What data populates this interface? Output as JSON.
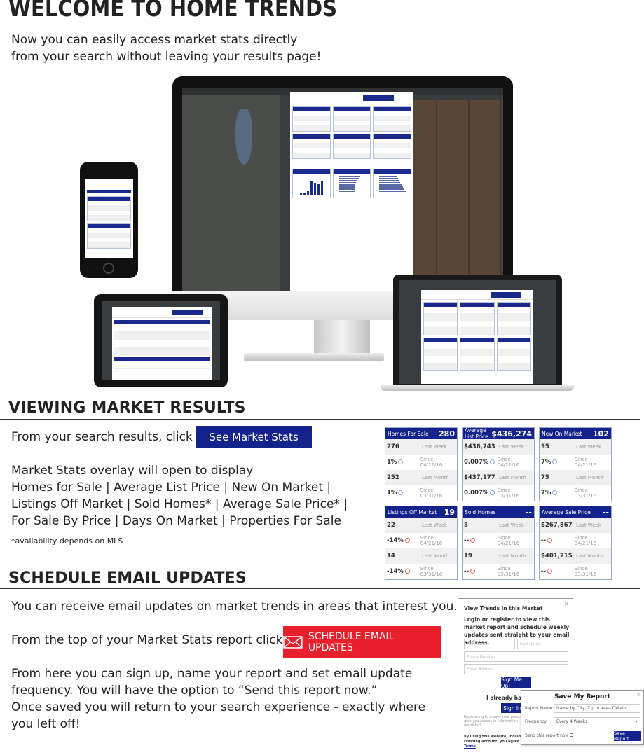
{
  "welcome": {
    "title": "WELCOME TO HOME TRENDS",
    "intro_line1": "Now you can easily access market stats directly",
    "intro_line2": "from your search without leaving your results page!"
  },
  "viewing": {
    "title": "VIEWING MARKET RESULTS",
    "click_text": "From your search results, click",
    "button_label": "See Market Stats",
    "overlay_line1": "Market Stats overlay will open to display",
    "overlay_line2": "Homes for Sale | Average List Price | New On Market |",
    "overlay_line3": "Listings Off Market | Sold Homes* | Average Sale Price* |",
    "overlay_line4": "For Sale By Price | Days On Market | Properties For Sale",
    "footnote": "*availability depends on MLS"
  },
  "stat_cards": [
    {
      "title": "Homes For Sale",
      "value": "280",
      "rows": [
        {
          "val": "276",
          "lbl": "Last Week",
          "icon": ""
        },
        {
          "val": "1%",
          "lbl": "Since 04/21/16",
          "icon": "question-icon"
        },
        {
          "val": "252",
          "lbl": "Last Month",
          "icon": ""
        },
        {
          "val": "1%",
          "lbl": "Since 03/31/16",
          "icon": "question-icon"
        }
      ]
    },
    {
      "title": "Average List Price",
      "value": "$436,274",
      "rows": [
        {
          "val": "$436,243",
          "lbl": "Last Week",
          "icon": ""
        },
        {
          "val": "0.007%",
          "lbl": "Since 04/21/16",
          "icon": "question-icon"
        },
        {
          "val": "$437,177",
          "lbl": "Last Month",
          "icon": ""
        },
        {
          "val": "0.007%",
          "lbl": "Since 03/31/16",
          "icon": "question-icon"
        }
      ]
    },
    {
      "title": "New On Market",
      "value": "102",
      "rows": [
        {
          "val": "95",
          "lbl": "Last Week",
          "icon": ""
        },
        {
          "val": "7%",
          "lbl": "Since 04/21/16",
          "icon": "question-icon"
        },
        {
          "val": "75",
          "lbl": "Last Month",
          "icon": ""
        },
        {
          "val": "7%",
          "lbl": "Since 03/31/16",
          "icon": "question-icon"
        }
      ]
    },
    {
      "title": "Listings Off Market",
      "value": "19",
      "rows": [
        {
          "val": "22",
          "lbl": "Last Week",
          "icon": ""
        },
        {
          "val": "-14%",
          "lbl": "Since 04/21/16",
          "icon": "down-arrow-icon"
        },
        {
          "val": "14",
          "lbl": "Last Month",
          "icon": ""
        },
        {
          "val": "-14%",
          "lbl": "Since 03/31/16",
          "icon": "down-arrow-icon"
        }
      ]
    },
    {
      "title": "Sold Homes",
      "value": "--",
      "rows": [
        {
          "val": "5",
          "lbl": "Last Week",
          "icon": ""
        },
        {
          "val": "--",
          "lbl": "Since 04/21/16",
          "icon": "down-arrow-icon"
        },
        {
          "val": "19",
          "lbl": "Last Month",
          "icon": ""
        },
        {
          "val": "--",
          "lbl": "Since 03/31/16",
          "icon": "down-arrow-icon"
        }
      ]
    },
    {
      "title": "Average Sale Price",
      "value": "--",
      "rows": [
        {
          "val": "$267,867",
          "lbl": "Last Week",
          "icon": ""
        },
        {
          "val": "--",
          "lbl": "Since 04/21/16",
          "icon": "down-arrow-icon"
        },
        {
          "val": "$401,215",
          "lbl": "Last Month",
          "icon": ""
        },
        {
          "val": "--",
          "lbl": "Since 03/31/16",
          "icon": "down-arrow-icon"
        }
      ]
    }
  ],
  "schedule": {
    "title": "SCHEDULE EMAIL UPDATES",
    "line1": "You can receive email updates on market trends in areas that interest you.",
    "click_text": "From the top of your Market Stats report click",
    "button_label": "SCHEDULE EMAIL UPDATES",
    "para_line1": "From here you can sign up, name your report and set email update",
    "para_line2": "frequency. You will have the option to “Send this report now.”",
    "para_line3": "Once saved you will return to your search experience - exactly where",
    "para_line4": "you left off!"
  },
  "login_dialog": {
    "title": "View Trends in this Market",
    "close": "×",
    "message": "Login or register to view this market report and schedule weekly updates sent straight to your email address.",
    "first_name_placeholder": "First Name",
    "last_name_placeholder": "Last Name",
    "phone_placeholder": "Phone Number",
    "email_placeholder": "Email Address",
    "signup_label": "Sign Me Up!",
    "already_have": "I already have a",
    "signin_label": "Sign In N",
    "register_note": "Registering to create your personal will give you access to information restricted.",
    "terms_text": "By using this website, including creating account, you agree to the",
    "terms_link": "Terms"
  },
  "save_dialog": {
    "title": "Save My Report",
    "close": "×",
    "report_name_label": "Report Name:",
    "report_name_placeholder": "Name by City, Zip or Area Details",
    "frequency_label": "Frequency:",
    "frequency_value": "Every 4 Weeks",
    "send_now": "Send this report now",
    "save_label": "Save Report"
  },
  "colors": {
    "brand_blue": "#14238c",
    "email_red": "#e8202e"
  }
}
